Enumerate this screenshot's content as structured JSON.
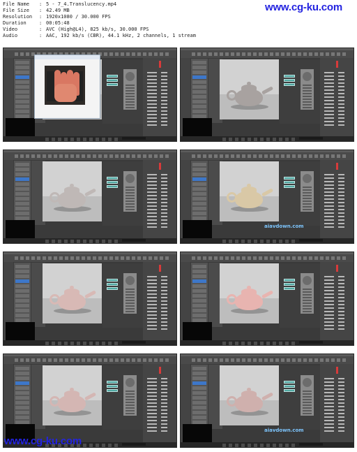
{
  "header": {
    "rows": [
      {
        "key": "File Name",
        "value": "5 - 7_4.Translucency.mp4"
      },
      {
        "key": "File Size",
        "value": "42.49 MB"
      },
      {
        "key": "Resolution",
        "value": "1920x1080 / 30.000 FPS"
      },
      {
        "key": "Duration",
        "value": "00:05:48"
      },
      {
        "key": "Video",
        "value": "AVC (High@L4), 825 kb/s, 30.000 FPS"
      },
      {
        "key": "Audio",
        "value": "AAC, 192 kb/s (CBR), 44.1 kHz, 2 channels, 1 stream"
      }
    ]
  },
  "watermarks": {
    "top": "www.cg-ku.com",
    "bottom": "www.cg-ku.com",
    "frame": "aiavdown.com"
  },
  "frames": [
    {
      "content": "hand-photo",
      "tint": "#9a8f88"
    },
    {
      "content": "teapot",
      "tint": "#a8a2a0"
    },
    {
      "content": "teapot",
      "tint": "#bfb8b6"
    },
    {
      "content": "teapot",
      "tint": "#d9c8a6",
      "watermark": true
    },
    {
      "content": "teapot",
      "tint": "#d8b9b5"
    },
    {
      "content": "teapot",
      "tint": "#e8b4b0"
    },
    {
      "content": "teapot",
      "tint": "#d4b6b3"
    },
    {
      "content": "teapot",
      "tint": "#cfb0ad",
      "watermark": true
    }
  ]
}
